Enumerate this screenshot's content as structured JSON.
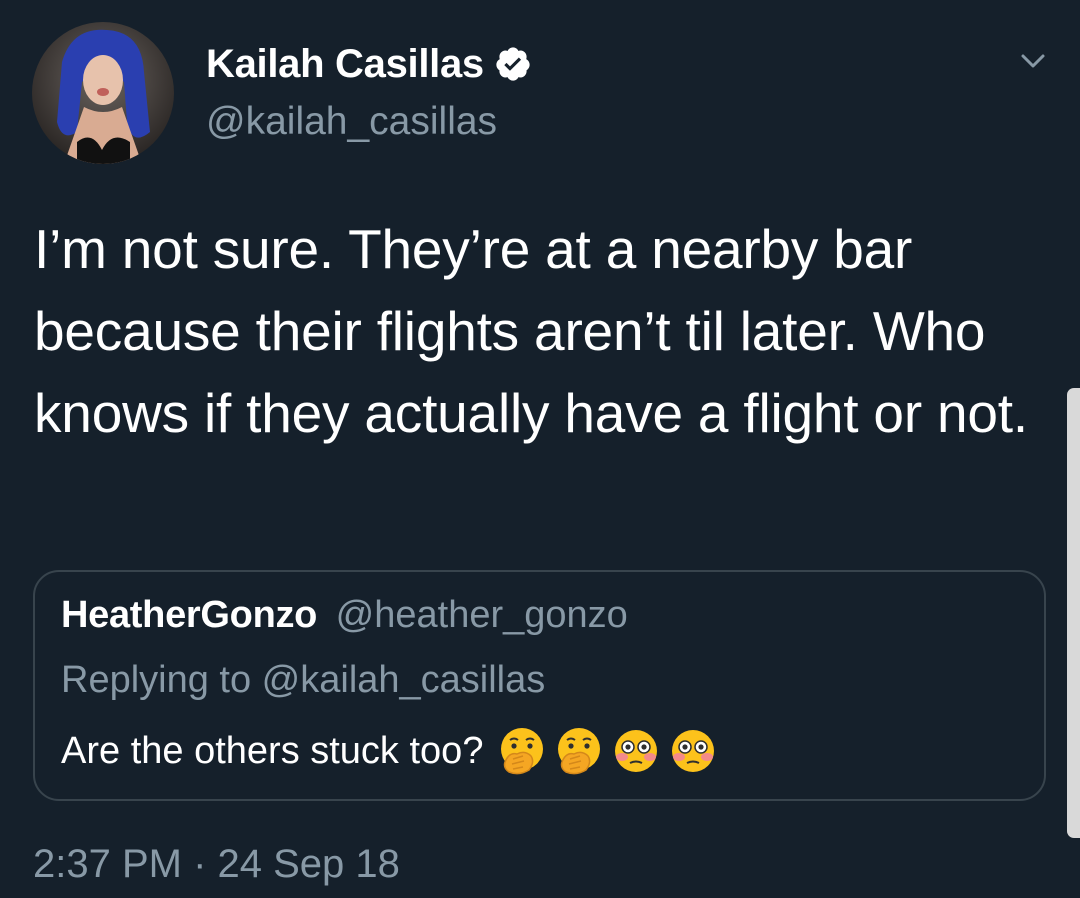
{
  "tweet": {
    "author": {
      "display_name": "Kailah Casillas",
      "handle": "@kailah_casillas",
      "verified": true,
      "avatar": "profile-photo"
    },
    "text": "I’m not sure. They’re at a nearby bar because their flights aren’t til later. Who knows if they actually have a flight or not.",
    "timestamp": "2:37 PM · 24 Sep 18",
    "menu_icon": "chevron-down-icon"
  },
  "quoted_tweet": {
    "display_name": "HeatherGonzo",
    "handle": "@heather_gonzo",
    "replying_to": "Replying to @kailah_casillas",
    "text": "Are the others stuck too?",
    "emojis": [
      "hand-over-mouth-emoji",
      "hand-over-mouth-emoji",
      "flushed-face-emoji",
      "flushed-face-emoji"
    ]
  },
  "colors": {
    "background": "#15202b",
    "primary_text": "#ffffff",
    "secondary_text": "#8899a6",
    "card_border": "#38444d"
  }
}
